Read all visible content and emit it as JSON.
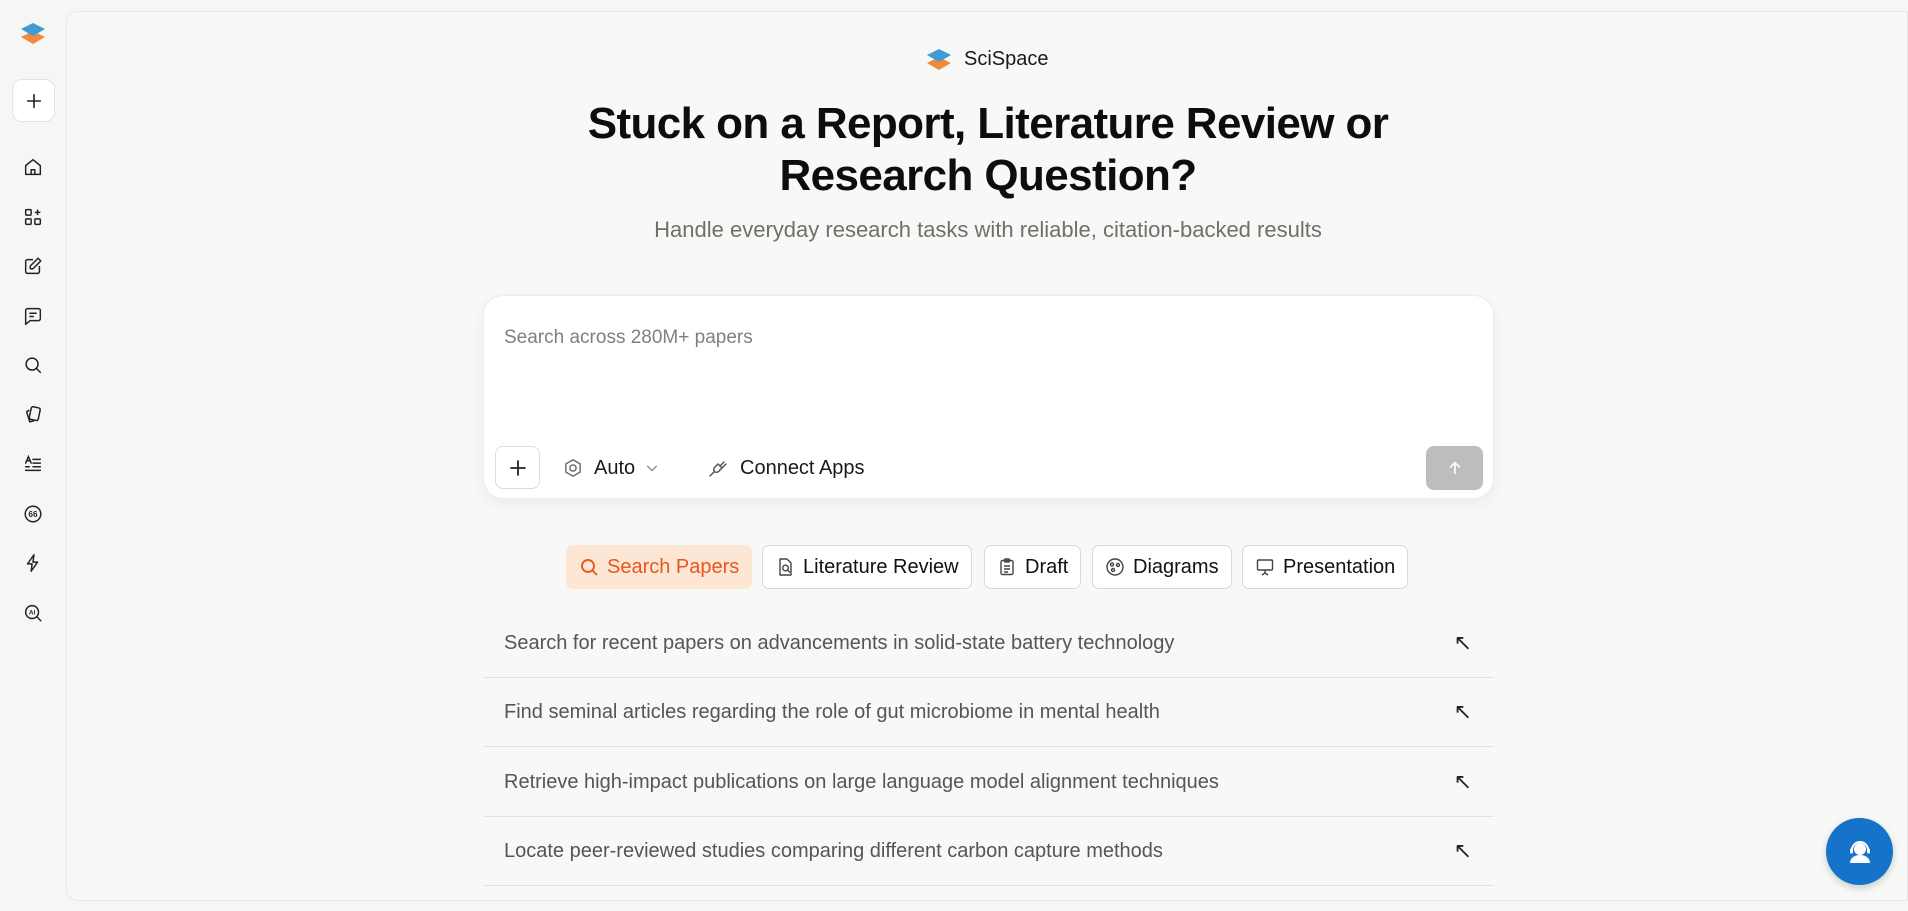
{
  "brand": {
    "name": "SciSpace"
  },
  "hero": {
    "title": "Stuck on a Report, Literature Review or Research Question?",
    "subtitle": "Handle everyday research tasks with reliable, citation-backed results"
  },
  "search": {
    "placeholder": "Search across 280M+ papers",
    "value": "",
    "model_label": "Auto",
    "connect_label": "Connect Apps"
  },
  "sidebar": {
    "items": [
      {
        "icon": "home-icon"
      },
      {
        "icon": "apps-grid-icon"
      },
      {
        "icon": "edit-icon"
      },
      {
        "icon": "chat-icon"
      },
      {
        "icon": "search-icon"
      },
      {
        "icon": "cards-icon"
      },
      {
        "icon": "text-list-icon"
      },
      {
        "icon": "quote-icon"
      },
      {
        "icon": "lightning-icon"
      },
      {
        "icon": "ai-detect-icon"
      }
    ]
  },
  "chips": [
    {
      "label": "Search Papers",
      "icon": "search-papers-icon",
      "active": true
    },
    {
      "label": "Literature Review",
      "icon": "literature-review-icon",
      "active": false
    },
    {
      "label": "Draft",
      "icon": "draft-icon",
      "active": false
    },
    {
      "label": "Diagrams",
      "icon": "diagrams-icon",
      "active": false
    },
    {
      "label": "Presentation",
      "icon": "presentation-icon",
      "active": false
    }
  ],
  "suggestions": [
    "Search for recent papers on advancements in solid-state battery technology",
    "Find seminal articles regarding the role of gut microbiome in mental health",
    "Retrieve high-impact publications on large language model alignment techniques",
    "Locate peer-reviewed studies comparing different carbon capture methods"
  ],
  "colors": {
    "accent": "#e8571d",
    "chip_active_bg": "#fde6d4",
    "help_button": "#1573c9",
    "send_disabled": "#bdbdbb"
  }
}
